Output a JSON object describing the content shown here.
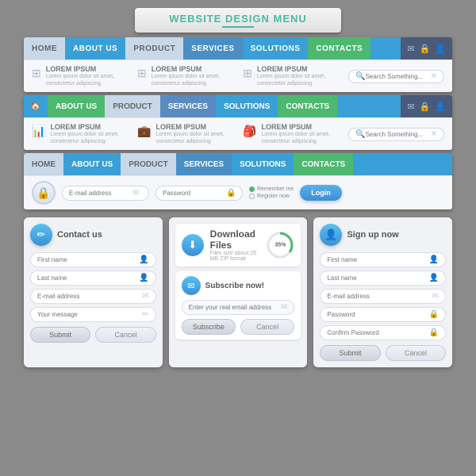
{
  "title": {
    "line1": "WEBSITE",
    "line2": "DESIGN",
    "line3": "MENU"
  },
  "nav1": {
    "items": [
      "HOME",
      "ABOUT US",
      "PRODUCT",
      "SERVICES",
      "SOLUTIONS",
      "CONTACTS"
    ],
    "lorem_blocks": [
      "LOREM IPSUM",
      "LOREM IPSUM",
      "LOREM IPSUM"
    ],
    "lorem_subs": [
      "Lorem ipsum dolor sit amet, consectetur adipiscing",
      "Lorem ipsum dolor sit amet, consectetur adipiscing",
      "Lorem ipsum dolor sit amet, consectetur adipiscing"
    ],
    "search_placeholder": "Search Something..."
  },
  "nav2": {
    "items": [
      "ABOUT US",
      "PRODUCT",
      "SERVICES",
      "SOLUTIONS",
      "CONTACTS"
    ],
    "lorem_blocks": [
      "LOREM IPSUM",
      "LOREM IPSUM",
      "LOREM IPSUM"
    ],
    "search_placeholder": "Search Something..."
  },
  "nav3": {
    "items": [
      "HOME",
      "ABOUT US",
      "PRODUCT",
      "SERVICES",
      "SOLUTIONS",
      "CONTACTS"
    ],
    "email_placeholder": "E-mail address",
    "password_placeholder": "Password",
    "remember_me": "Remember me",
    "register_now": "Register now",
    "login_btn": "Login"
  },
  "contact_panel": {
    "title": "Contact us",
    "icon": "✏",
    "fields": [
      {
        "placeholder": "First name",
        "icon": "👤"
      },
      {
        "placeholder": "Last name",
        "icon": "👤"
      },
      {
        "placeholder": "E-mail address",
        "icon": "✉"
      },
      {
        "placeholder": "Your message",
        "icon": "✏"
      }
    ],
    "submit_label": "Submit",
    "cancel_label": "Cancel"
  },
  "download_panel": {
    "title": "Download Files",
    "subtitle": "Files size about 25 MB ZIP format",
    "icon": "⬇",
    "percent": "35%",
    "subscribe_title": "Subscribe now!",
    "subscribe_placeholder": "Enter your real email address",
    "subscribe_btn": "Subscribe",
    "cancel_btn": "Cancel"
  },
  "signup_panel": {
    "title": "Sign up now",
    "icon": "👤",
    "fields": [
      {
        "placeholder": "First name",
        "icon": "👤"
      },
      {
        "placeholder": "Last name",
        "icon": "👤"
      },
      {
        "placeholder": "E-mail address",
        "icon": "✉"
      },
      {
        "placeholder": "Password",
        "icon": "🔒"
      },
      {
        "placeholder": "Confirm Password",
        "icon": "🔒"
      }
    ],
    "submit_label": "Submit",
    "cancel_label": "Cancel"
  }
}
